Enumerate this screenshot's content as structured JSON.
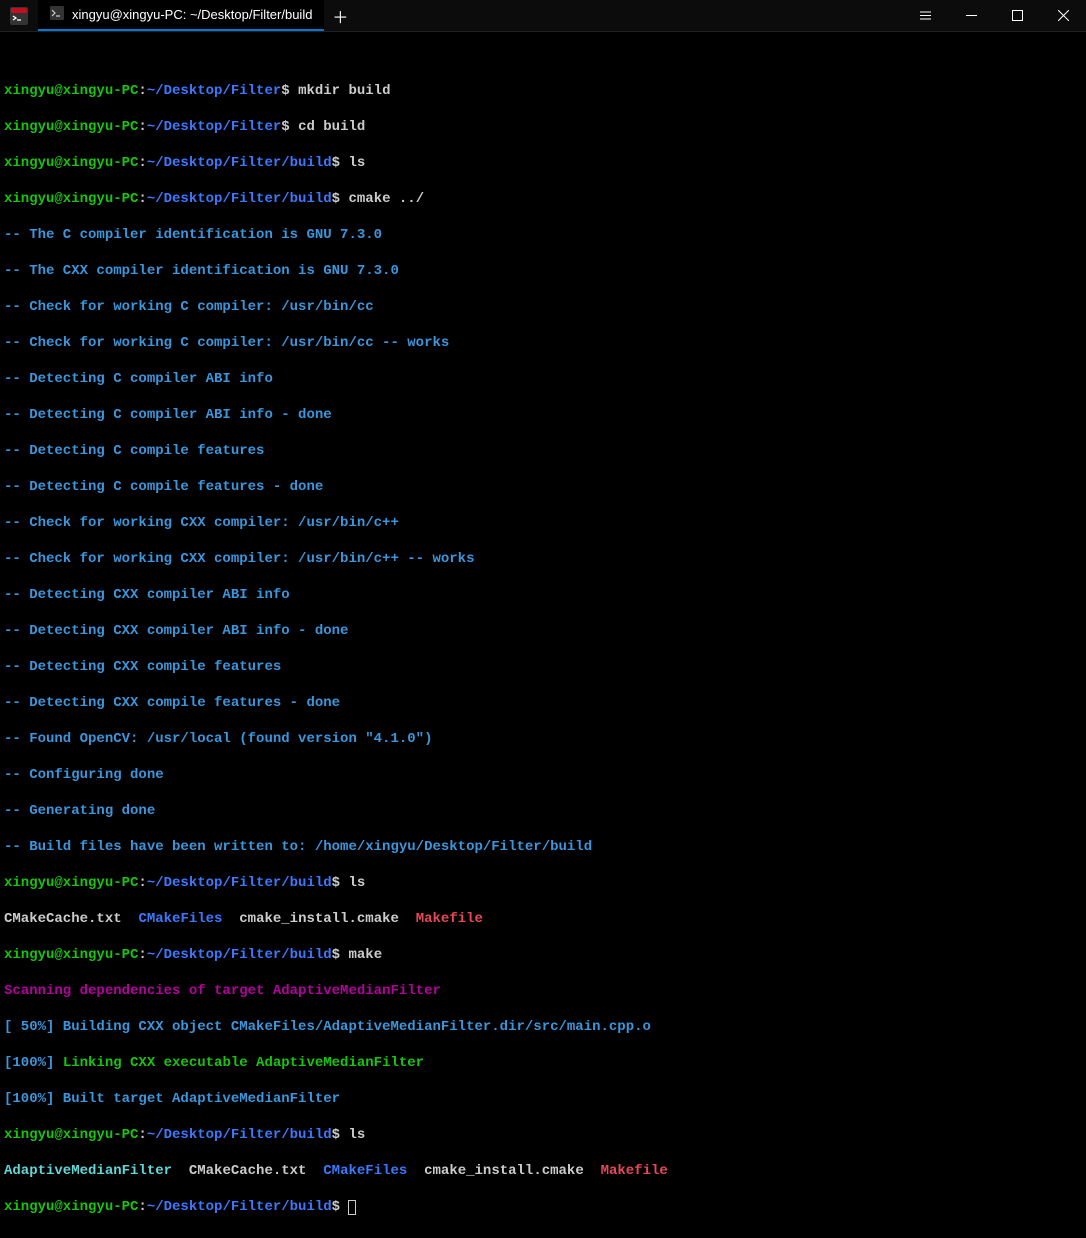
{
  "tab": {
    "title": "xingyu@xingyu-PC: ~/Desktop/Filter/build"
  },
  "prompt": {
    "user_host": "xingyu@xingyu-PC",
    "path_filter": "~/Desktop/Filter",
    "path_build": "~/Desktop/Filter/build",
    "dollar": "$"
  },
  "commands": {
    "mkdir": "mkdir build",
    "cd": "cd build",
    "ls": "ls",
    "cmake": "cmake ../",
    "make": "make"
  },
  "cmake_out": [
    "-- The C compiler identification is GNU 7.3.0",
    "-- The CXX compiler identification is GNU 7.3.0",
    "-- Check for working C compiler: /usr/bin/cc",
    "-- Check for working C compiler: /usr/bin/cc -- works",
    "-- Detecting C compiler ABI info",
    "-- Detecting C compiler ABI info - done",
    "-- Detecting C compile features",
    "-- Detecting C compile features - done",
    "-- Check for working CXX compiler: /usr/bin/c++",
    "-- Check for working CXX compiler: /usr/bin/c++ -- works",
    "-- Detecting CXX compiler ABI info",
    "-- Detecting CXX compiler ABI info - done",
    "-- Detecting CXX compile features",
    "-- Detecting CXX compile features - done",
    "-- Found OpenCV: /usr/local (found version \"4.1.0\")",
    "-- Configuring done",
    "-- Generating done",
    "-- Build files have been written to: /home/xingyu/Desktop/Filter/build"
  ],
  "ls1": {
    "cmakecache": "CMakeCache.txt",
    "cmakefiles": "CMakeFiles",
    "cmakeinstall": "cmake_install.cmake",
    "makefile": "Makefile"
  },
  "make_out": {
    "scanning": "Scanning dependencies of target AdaptiveMedianFilter",
    "building": "[ 50%] Building CXX object CMakeFiles/AdaptiveMedianFilter.dir/src/main.cpp.o",
    "linking_pct": "[100%] ",
    "linking": "Linking CXX executable AdaptiveMedianFilter",
    "built": "[100%] Built target AdaptiveMedianFilter"
  },
  "ls2": {
    "exe": "AdaptiveMedianFilter",
    "cmakecache": "CMakeCache.txt",
    "cmakefiles": "CMakeFiles",
    "cmakeinstall": "cmake_install.cmake",
    "makefile": "Makefile"
  }
}
